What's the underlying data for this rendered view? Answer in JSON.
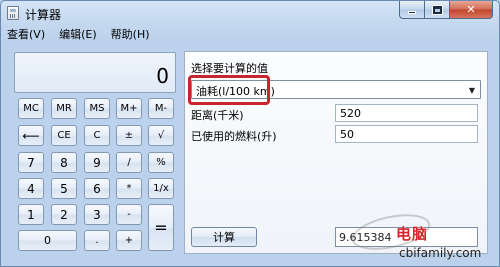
{
  "window": {
    "title": "计算器"
  },
  "menu": [
    "查看(V)",
    "编辑(E)",
    "帮助(H)"
  ],
  "display": {
    "value": "0"
  },
  "keys": {
    "r1": [
      "MC",
      "MR",
      "MS",
      "M+",
      "M-"
    ],
    "r2": [
      "⟵",
      "CE",
      "C",
      "±",
      "√"
    ],
    "r3": [
      "7",
      "8",
      "9",
      "/",
      "%"
    ],
    "r4": [
      "4",
      "5",
      "6",
      "*",
      "1/x"
    ],
    "r5": [
      "1",
      "2",
      "3",
      "-",
      "="
    ],
    "r6": [
      "0",
      ".",
      "+"
    ]
  },
  "options": {
    "select_label": "选择要计算的值",
    "selected": "油耗(l/100 km)",
    "field1_label": "距离(千米)",
    "field1_value": "520",
    "field2_label": "已使用的燃料(升)",
    "field2_value": "50",
    "calc_button": "计算",
    "result": "9.615384"
  },
  "watermark": {
    "logo": "电脑",
    "url": "cbifamily.com"
  },
  "colors": {
    "highlight": "#c8262f",
    "close": "#c04529"
  }
}
